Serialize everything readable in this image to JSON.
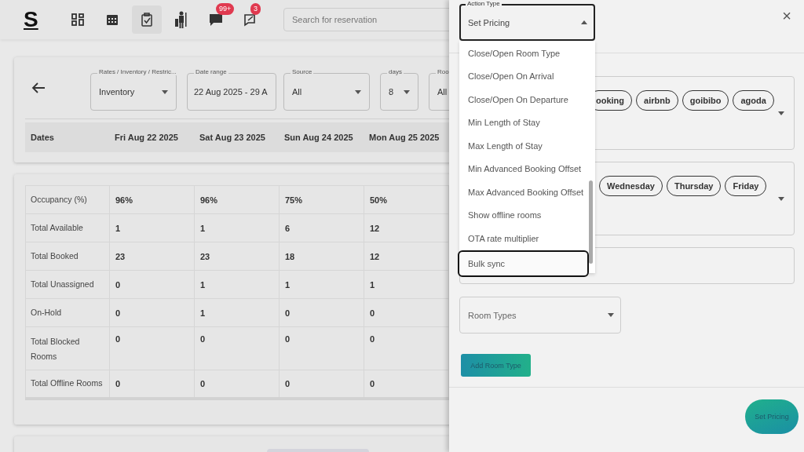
{
  "topbar": {
    "logo": "S",
    "nav": [
      {
        "kind": "grid",
        "selected": false
      },
      {
        "kind": "calendar",
        "selected": false
      },
      {
        "kind": "clipboard",
        "selected": true
      },
      {
        "kind": "porter",
        "selected": false
      },
      {
        "kind": "chat",
        "selected": false,
        "badge": "99+"
      },
      {
        "kind": "note",
        "selected": false,
        "badge": "3"
      }
    ],
    "search": {
      "placeholder": "Search for reservation"
    }
  },
  "filters": [
    {
      "label": "Rates / Inventory / Restric...",
      "value": "Inventory",
      "dropdown": true
    },
    {
      "label": "Date range",
      "value": "22 Aug 2025 - 29 A",
      "dropdown": false
    },
    {
      "label": "Source",
      "value": "All",
      "dropdown": true
    },
    {
      "label": "days",
      "value": "8",
      "dropdown": true
    },
    {
      "label": "Roo",
      "value": "All",
      "dropdown": false
    }
  ],
  "table": {
    "columns": [
      "Dates",
      "Fri Aug 22 2025",
      "Sat Aug 23 2025",
      "Sun Aug 24 2025",
      "Mon Aug 25 2025"
    ],
    "rows": [
      [
        "Occupancy (%)",
        "96%",
        "96%",
        "75%",
        "50%"
      ],
      [
        "Total Available",
        "1",
        "1",
        "6",
        "12"
      ],
      [
        "Total Booked",
        "23",
        "23",
        "18",
        "12"
      ],
      [
        "Total Unassigned",
        "0",
        "1",
        "1",
        "1"
      ],
      [
        "On-Hold",
        "0",
        "1",
        "0",
        "0"
      ],
      [
        "Total Blocked Rooms",
        "0",
        "0",
        "0",
        "0"
      ],
      [
        "Total Offline Rooms",
        "0",
        "0",
        "0",
        "0"
      ]
    ]
  },
  "drawer": {
    "action_type": {
      "label": "Action Type",
      "value": "Set Pricing",
      "expanded": true,
      "options": [
        {
          "label": "Close/Open Room Type",
          "selected": false
        },
        {
          "label": "Close/Open On Arrival",
          "selected": false
        },
        {
          "label": "Close/Open On Departure",
          "selected": false
        },
        {
          "label": "Min Length of Stay",
          "selected": false
        },
        {
          "label": "Max Length of Stay",
          "selected": false
        },
        {
          "label": "Min Advanced Booking Offset",
          "selected": false
        },
        {
          "label": "Max Advanced Booking Offset",
          "selected": false
        },
        {
          "label": "Show offline rooms",
          "selected": false
        },
        {
          "label": "OTA rate multiplier",
          "selected": false
        },
        {
          "label": "Bulk sync",
          "selected": true
        }
      ]
    },
    "close": "×",
    "sources": [
      "ooking",
      "airbnb",
      "goibibo",
      "agoda"
    ],
    "weekdays": [
      "Wednesday",
      "Thursday",
      "Friday"
    ],
    "room_types": {
      "placeholder": "Room Types"
    },
    "add_button": "Add Room Type",
    "submit_button": "Set Pricing"
  }
}
